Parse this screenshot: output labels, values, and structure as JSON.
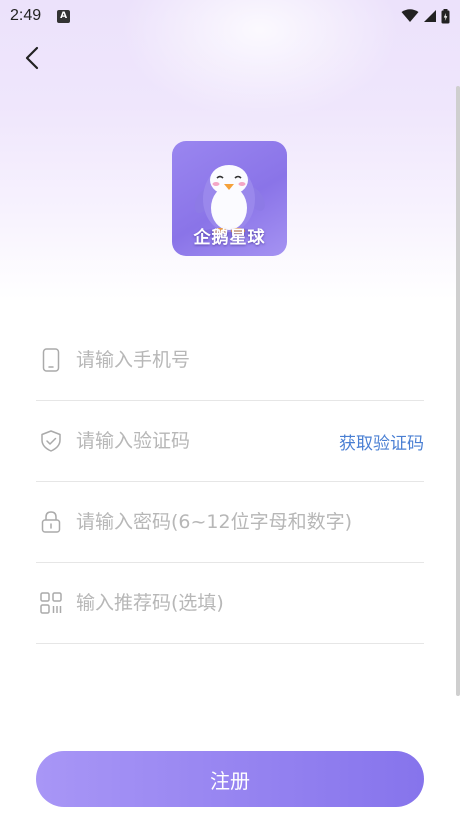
{
  "status_bar": {
    "time": "2:49",
    "notification_icon": "a-letter-icon",
    "wifi_icon": "wifi-icon",
    "signal_icon": "signal-icon",
    "battery_icon": "battery-icon"
  },
  "header": {
    "back_icon": "chevron-left-icon"
  },
  "logo": {
    "text": "企鹅星球",
    "mascot": "penguin-mascot"
  },
  "form": {
    "phone_placeholder": "请输入手机号",
    "code_placeholder": "请输入验证码",
    "get_code_label": "获取验证码",
    "password_placeholder": "请输入密码(6~12位字母和数字)",
    "referral_placeholder": "输入推荐码(选填)"
  },
  "register_label": "注册",
  "colors": {
    "accent": "#8674ec",
    "link": "#4a7fd3",
    "placeholder": "#b7b7b7"
  }
}
